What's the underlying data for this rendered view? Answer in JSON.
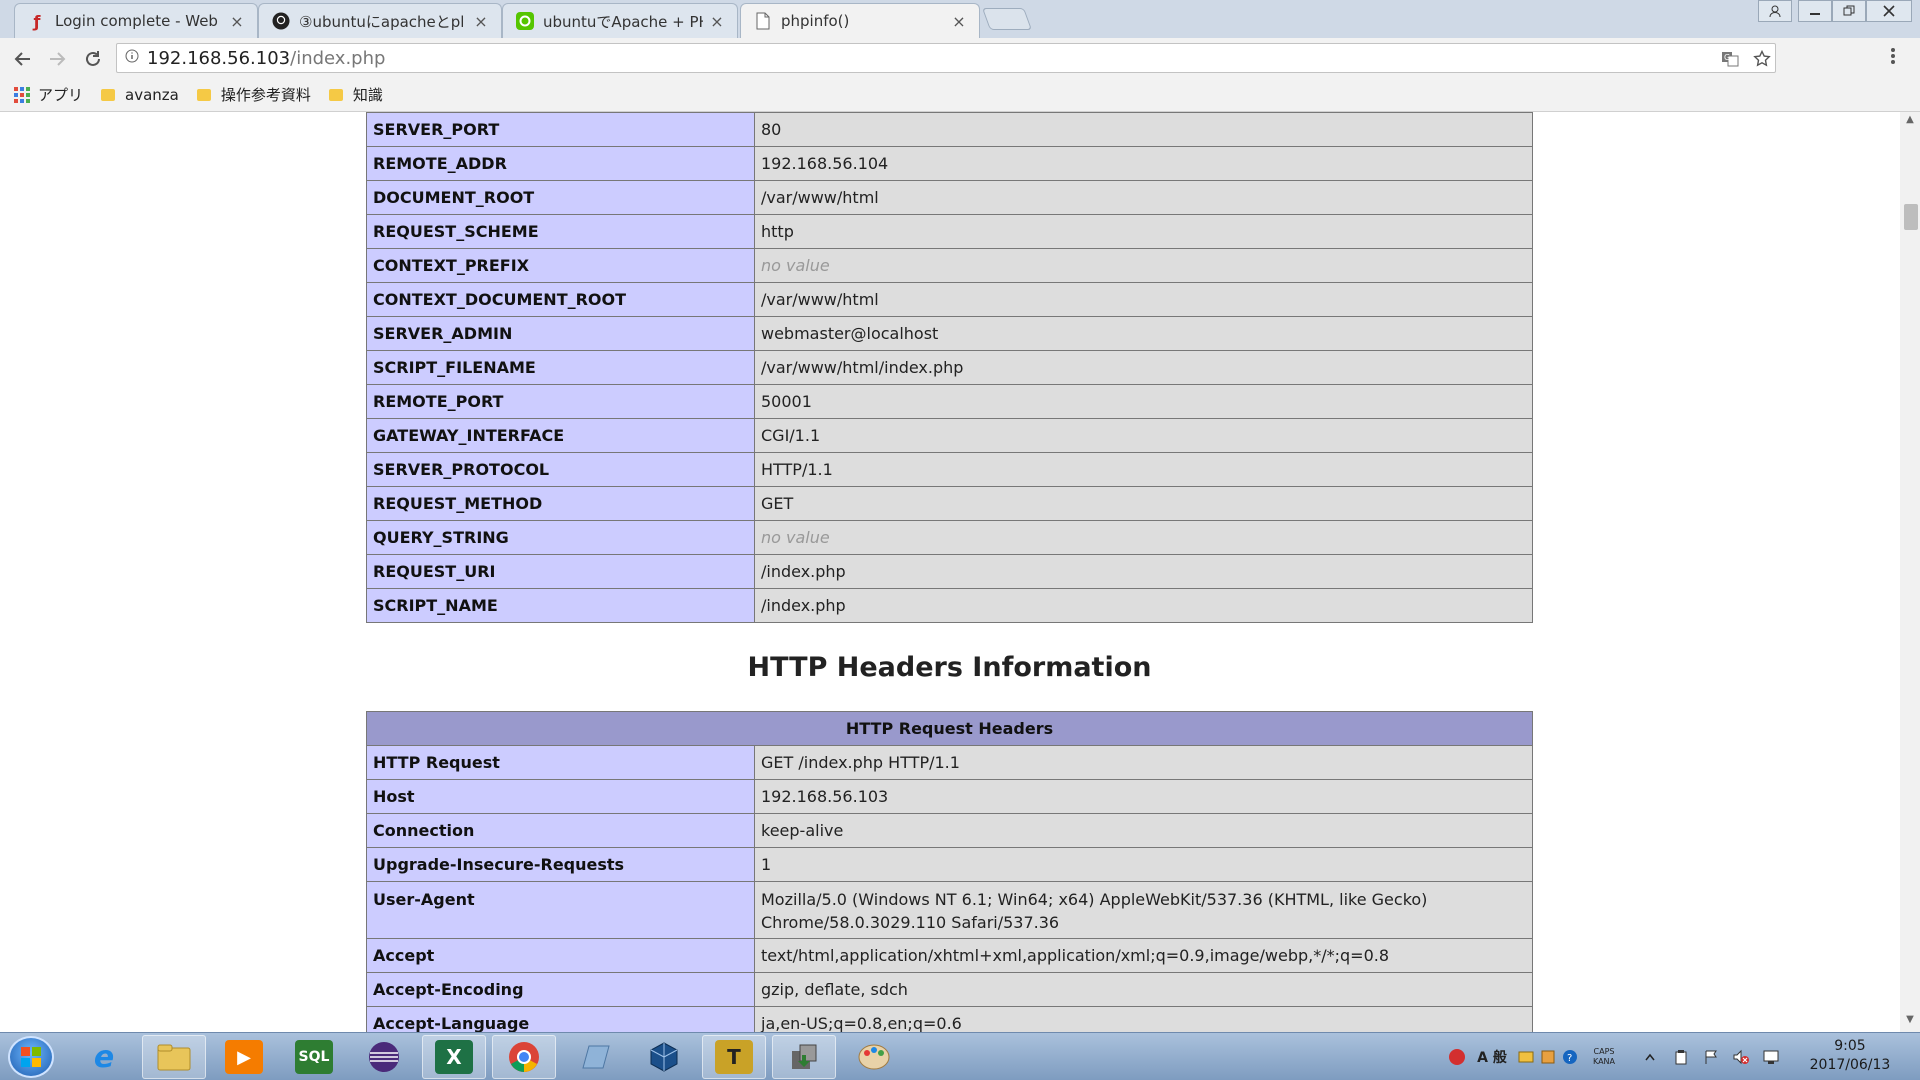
{
  "browser": {
    "tabs": [
      {
        "title": "Login complete - Web",
        "favicon": "flash-icon",
        "color": "#c62828"
      },
      {
        "title": "③ubuntuにapacheとpl",
        "favicon": "github-icon",
        "color": "#222222"
      },
      {
        "title": "ubuntuでApache + PH",
        "favicon": "qiita-icon",
        "color": "#55c500"
      },
      {
        "title": "phpinfo()",
        "favicon": "page-icon",
        "color": "#666666",
        "active": true
      }
    ],
    "close_glyph": "×",
    "address": {
      "host": "192.168.56.103",
      "path": "/index.php"
    },
    "bookmarks": [
      {
        "label": "アプリ",
        "icon": "apps-grid-icon"
      },
      {
        "label": "avanza",
        "icon": "folder-icon"
      },
      {
        "label": "操作参考資料",
        "icon": "folder-icon"
      },
      {
        "label": "知識",
        "icon": "folder-icon"
      }
    ]
  },
  "apache_env_rows": [
    {
      "key": "SERVER_PORT",
      "value": "80"
    },
    {
      "key": "REMOTE_ADDR",
      "value": "192.168.56.104"
    },
    {
      "key": "DOCUMENT_ROOT",
      "value": "/var/www/html"
    },
    {
      "key": "REQUEST_SCHEME",
      "value": "http"
    },
    {
      "key": "CONTEXT_PREFIX",
      "value": "no value",
      "no_value": true
    },
    {
      "key": "CONTEXT_DOCUMENT_ROOT",
      "value": "/var/www/html"
    },
    {
      "key": "SERVER_ADMIN",
      "value": "webmaster@localhost"
    },
    {
      "key": "SCRIPT_FILENAME",
      "value": "/var/www/html/index.php"
    },
    {
      "key": "REMOTE_PORT",
      "value": "50001"
    },
    {
      "key": "GATEWAY_INTERFACE",
      "value": "CGI/1.1"
    },
    {
      "key": "SERVER_PROTOCOL",
      "value": "HTTP/1.1"
    },
    {
      "key": "REQUEST_METHOD",
      "value": "GET"
    },
    {
      "key": "QUERY_STRING",
      "value": "no value",
      "no_value": true
    },
    {
      "key": "REQUEST_URI",
      "value": "/index.php"
    },
    {
      "key": "SCRIPT_NAME",
      "value": "/index.php"
    }
  ],
  "http_headers": {
    "section_title": "HTTP Headers Information",
    "table_header": "HTTP Request Headers",
    "rows": [
      {
        "key": "HTTP Request",
        "value": "GET /index.php HTTP/1.1"
      },
      {
        "key": "Host",
        "value": "192.168.56.103"
      },
      {
        "key": "Connection",
        "value": "keep-alive"
      },
      {
        "key": "Upgrade-Insecure-Requests",
        "value": "1"
      },
      {
        "key": "User-Agent",
        "value": "Mozilla/5.0 (Windows NT 6.1; Win64; x64) AppleWebKit/537.36 (KHTML, like Gecko)",
        "value2": "Chrome/58.0.3029.110 Safari/537.36"
      },
      {
        "key": "Accept",
        "value": "text/html,application/xhtml+xml,application/xml;q=0.9,image/webp,*/*;q=0.8"
      },
      {
        "key": "Accept-Encoding",
        "value": "gzip, deflate, sdch"
      },
      {
        "key": "Accept-Language",
        "value": "ja,en-US;q=0.8,en;q=0.6"
      }
    ]
  },
  "taskbar": {
    "apps": [
      {
        "name": "internet-explorer",
        "glyph": "e",
        "color": "#1e88e5"
      },
      {
        "name": "file-explorer",
        "glyph": "",
        "color": "#e8c55a",
        "running": true
      },
      {
        "name": "media-player",
        "glyph": "▶",
        "color": "#f57c00"
      },
      {
        "name": "sql-developer",
        "glyph": "SQL",
        "color": "#2e7d32"
      },
      {
        "name": "eclipse",
        "glyph": "",
        "color": "#4a2a7a"
      },
      {
        "name": "excel",
        "glyph": "X",
        "color": "#1e7145",
        "running": true
      },
      {
        "name": "chrome",
        "glyph": "",
        "color": "#db4437",
        "running": true
      },
      {
        "name": "notepad",
        "glyph": "",
        "color": "#8fb3d8"
      },
      {
        "name": "virtualbox",
        "glyph": "",
        "color": "#1b4f8a"
      },
      {
        "name": "teraterm",
        "glyph": "T",
        "color": "#c9a227",
        "running": true
      },
      {
        "name": "winscp",
        "glyph": "",
        "color": "#666666",
        "running": true
      },
      {
        "name": "paint",
        "glyph": "",
        "color": "#e0a040"
      }
    ],
    "ime_label": "A 般",
    "caps_label": "CAPS",
    "kana_label": "KANA",
    "time": "9:05",
    "date": "2017/06/13"
  }
}
